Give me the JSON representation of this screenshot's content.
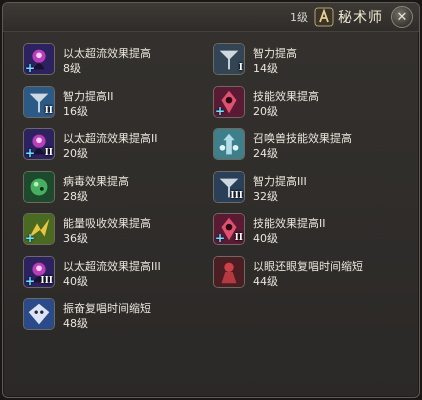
{
  "window": {
    "level_label": "1级",
    "job_name": "秘术师",
    "close_glyph": "✕"
  },
  "actions": [
    {
      "name": "以太超流效果提高",
      "level": "8级",
      "icon": "aetherflow-trait-icon",
      "bg": "#2c2260",
      "accent": "#d243c9",
      "badge": "",
      "plus": true
    },
    {
      "name": "智力提高",
      "level": "14级",
      "icon": "intelligence-icon",
      "bg": "#334454",
      "accent": "#cfd8e0",
      "badge": "I",
      "plus": false
    },
    {
      "name": "智力提高II",
      "level": "16级",
      "icon": "intelligence-icon",
      "bg": "#2c5a86",
      "accent": "#cfd8e0",
      "badge": "II",
      "plus": false
    },
    {
      "name": "技能效果提高",
      "level": "20级",
      "icon": "enhanced-skill-icon",
      "bg": "#5a1a34",
      "accent": "#e05070",
      "badge": "",
      "plus": true
    },
    {
      "name": "以太超流效果提高II",
      "level": "20级",
      "icon": "aetherflow-trait-icon",
      "bg": "#2c2260",
      "accent": "#d243c9",
      "badge": "II",
      "plus": true
    },
    {
      "name": "召唤兽技能效果提高",
      "level": "24级",
      "icon": "summon-enhance-icon",
      "bg": "#3f7f8a",
      "accent": "#bfe8ef",
      "badge": "",
      "plus": false
    },
    {
      "name": "病毒效果提高",
      "level": "28级",
      "icon": "virus-enhance-icon",
      "bg": "#1d4a2c",
      "accent": "#47b060",
      "badge": "",
      "plus": false
    },
    {
      "name": "智力提高III",
      "level": "32级",
      "icon": "intelligence-icon",
      "bg": "#2a3f58",
      "accent": "#cfd8e0",
      "badge": "III",
      "plus": false
    },
    {
      "name": "能量吸收效果提高",
      "level": "36级",
      "icon": "energy-drain-icon",
      "bg": "#4a6a22",
      "accent": "#e8c640",
      "badge": "",
      "plus": true
    },
    {
      "name": "技能效果提高II",
      "level": "40级",
      "icon": "enhanced-skill-icon",
      "bg": "#5a1a34",
      "accent": "#e05070",
      "badge": "II",
      "plus": true
    },
    {
      "name": "以太超流效果提高III",
      "level": "40级",
      "icon": "aetherflow-trait-icon",
      "bg": "#2c2260",
      "accent": "#d243c9",
      "badge": "III",
      "plus": true
    },
    {
      "name": "以眼还眼复唱时间缩短",
      "level": "44级",
      "icon": "eye-for-eye-icon",
      "bg": "#4a1e22",
      "accent": "#d04048",
      "badge": "",
      "plus": false
    },
    {
      "name": "振奋复唱时间缩短",
      "level": "48级",
      "icon": "rouse-icon",
      "bg": "#2a4a8a",
      "accent": "#f0f4ff",
      "badge": "",
      "plus": false
    }
  ]
}
